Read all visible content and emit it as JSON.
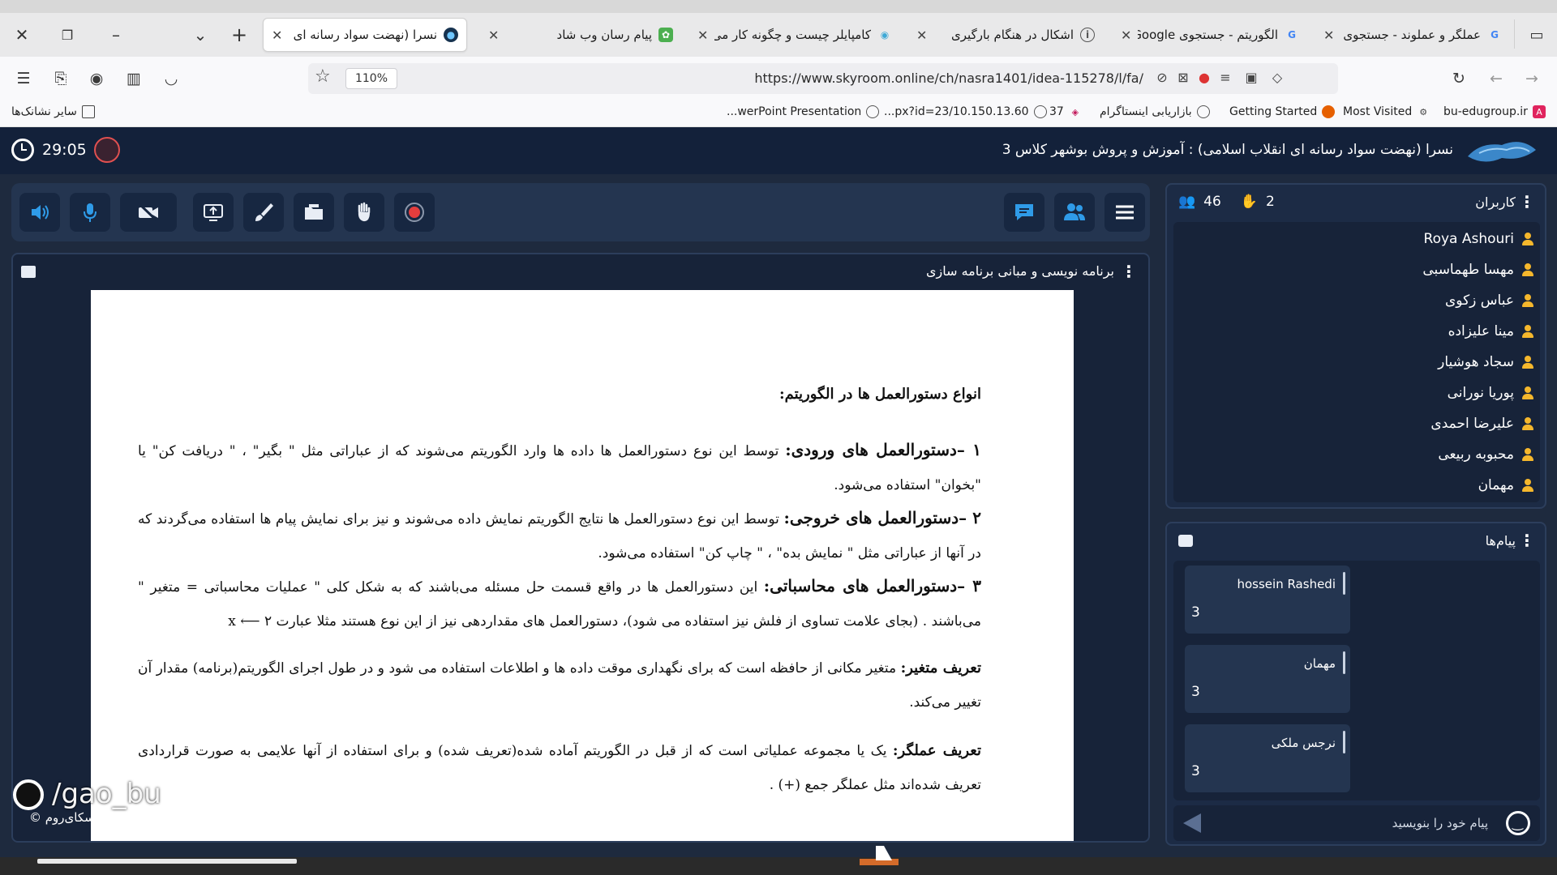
{
  "browser": {
    "tabs": [
      {
        "title": "عملگر و عملوند - جستجوی Google",
        "favicon_letter": "G",
        "favicon_color": "#4285f4"
      },
      {
        "title": "الگوریتم - جستجوی Google",
        "favicon_letter": "G",
        "favicon_color": "#4285f4"
      },
      {
        "title": "اشکال در هنگام بارگیری",
        "favicon_letter": "i",
        "favicon_color": "#555555"
      },
      {
        "title": "کامپایلر چیست و چگونه کار می",
        "favicon_letter": "◉",
        "favicon_color": "#3fa9d6"
      },
      {
        "title": "پیام رسان وب شاد",
        "favicon_letter": "✿",
        "favicon_color": "#4caf50"
      },
      {
        "title": "نسرا (نهضت سواد رسانه ای",
        "favicon_letter": "●",
        "favicon_color": "#16324f"
      }
    ],
    "zoom": "110%",
    "url": "https://www.skyroom.online/ch/nasra1401/idea-115278/l/fa/",
    "bookmarks": [
      {
        "label": "bu-edugroup.ir",
        "icon_color": "#e0245e"
      },
      {
        "label": "Most Visited",
        "icon_color": "#444444"
      },
      {
        "label": "Getting Started",
        "icon_color": "#e66000"
      },
      {
        "label": "بازاریابی اینستاگرام",
        "icon_color": "#555555"
      },
      {
        "label": "37",
        "icon_color": "#c2185b"
      },
      {
        "label": "...px?id=23/10.150.13.60",
        "icon_color": "#555555"
      },
      {
        "label": "...werPoint Presentation",
        "icon_color": "#555555"
      },
      {
        "label": "سایر نشانک‌ها",
        "icon_color": "#444444"
      }
    ]
  },
  "app": {
    "room_title": "نسرا (نهضت سواد رسانه ای انقلاب اسلامی) : آموزش و پروش بوشهر کلاس 3",
    "timer": "29:05",
    "accent_color": "#2f7de0"
  },
  "document": {
    "title": "برنامه نویسی و مبانی برنامه سازی",
    "heading": "انواع دستورالعمل ها در الگوریتم:",
    "items": [
      {
        "number": "۱",
        "term": "دستورالعمل های ورودی:",
        "text": "توسط این نوع دستورالعمل ها داده ها وارد الگوریتم می‌شوند که از عباراتی مثل \" بگیر\" ، \" دریافت کن\" یا \"بخوان\" استفاده می‌شود."
      },
      {
        "number": "۲",
        "term": "دستورالعمل های خروجی:",
        "text": "توسط این نوع دستورالعمل ها نتایج الگوریتم نمایش داده می‌شوند و نیز برای نمایش پیام ها استفاده می‌گردند که در آنها از عباراتی مثل \" نمایش بده\" ، \" چاپ کن\" استفاده می‌شود."
      },
      {
        "number": "۳",
        "term": "دستورالعمل های محاسباتی:",
        "text": "این دستورالعمل ها در واقع قسمت حل مسئله می‌باشند که به شکل کلی \" عملیات محاسباتی = متغیر \" می‌باشند . (بجای علامت تساوی از فلش نیز استفاده می شود)، دستورالعمل های مقداردهی نیز از این نوع هستند مثلا عبارت ۲ ⟵ x"
      }
    ],
    "definitions": [
      {
        "term": "تعریف متغیر:",
        "text": "متغیر مکانی از حافظه است که برای نگهداری موقت داده ها و اطلاعات استفاده می شود و در طول اجرای الگوریتم(برنامه) مقدار آن تغییر می‌کند."
      },
      {
        "term": "تعریف عملگر:",
        "text": "یک یا مجموعه عملیاتی است که از قبل در الگوریتم آماده شده(تعریف شده) و برای استفاده از آنها علایمی به صورت قراردادی تعریف شده‌اند مثل عملگر جمع (+) ."
      }
    ]
  },
  "watermark": {
    "handle": "/gao_bu",
    "brand": "اسکای‌روم ©"
  },
  "users": {
    "title": "کاربران",
    "count": "46",
    "raised_hands": "2",
    "list": [
      "Roya Ashouri",
      "مهسا طهماسبی",
      "عباس زکوی",
      "مینا علیزاده",
      "سجاد هوشیار",
      "پوریا نورانی",
      "علیرضا احمدی",
      "محبوبه ربیعی",
      "مهمان"
    ]
  },
  "messages": {
    "title": "پیام‌ها",
    "placeholder": "پیام خود را بنویسید",
    "list": [
      {
        "sender": "hossein Rashedi",
        "body": "3"
      },
      {
        "sender": "مهمان",
        "body": "3"
      },
      {
        "sender": "نرجس ملکی",
        "body": "3"
      }
    ]
  }
}
